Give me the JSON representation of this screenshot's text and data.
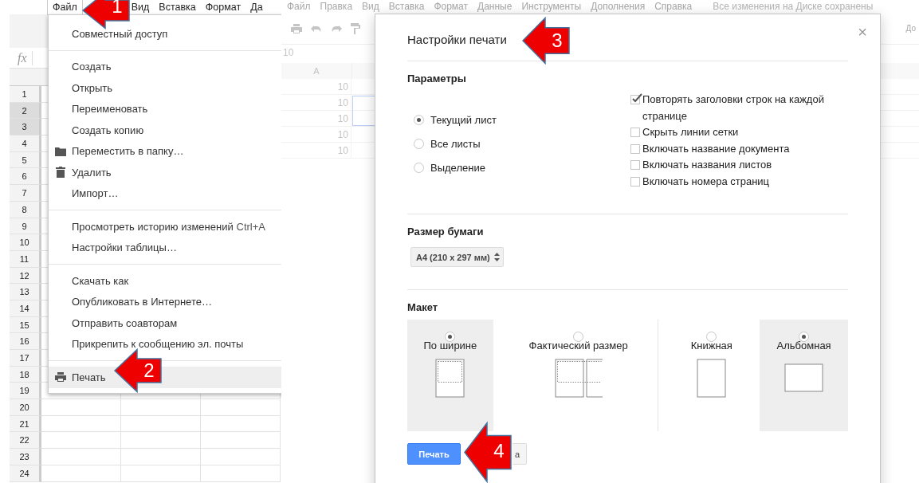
{
  "left_sheet": {
    "menu_bar": [
      {
        "label": "Файл",
        "open": true
      },
      {
        "label": "Вид",
        "open": false
      },
      {
        "label": "Вставка",
        "open": false
      },
      {
        "label": "Формат",
        "open": false
      },
      {
        "label": "Да",
        "open": false
      }
    ],
    "formula_icon": "fx",
    "rows": [
      {
        "label": "1",
        "selected": false
      },
      {
        "label": "2",
        "selected": true
      },
      {
        "label": "3",
        "selected": true
      },
      {
        "label": "4",
        "selected": false
      },
      {
        "label": "5",
        "selected": false
      },
      {
        "label": "6",
        "selected": false
      },
      {
        "label": "7",
        "selected": false
      },
      {
        "label": "8",
        "selected": false
      },
      {
        "label": "9",
        "selected": false
      },
      {
        "label": "10",
        "selected": false
      },
      {
        "label": "11",
        "selected": false
      },
      {
        "label": "12",
        "selected": false
      },
      {
        "label": "13",
        "selected": false
      },
      {
        "label": "14",
        "selected": false
      },
      {
        "label": "15",
        "selected": false
      },
      {
        "label": "16",
        "selected": false
      },
      {
        "label": "17",
        "selected": false
      },
      {
        "label": "18",
        "selected": false
      },
      {
        "label": "19",
        "selected": false
      },
      {
        "label": "20",
        "selected": false
      },
      {
        "label": "21",
        "selected": false
      },
      {
        "label": "22",
        "selected": false
      },
      {
        "label": "23",
        "selected": false
      },
      {
        "label": "24",
        "selected": false
      }
    ]
  },
  "file_menu": {
    "groups": [
      [
        {
          "label": "Совместный доступ",
          "kind": "plain",
          "highlighted": false
        }
      ],
      [
        {
          "label": "Создать",
          "kind": "plain",
          "highlighted": false
        },
        {
          "label": "Открыть",
          "kind": "plain",
          "highlighted": false
        },
        {
          "label": "Переименовать",
          "kind": "plain",
          "highlighted": false
        },
        {
          "label": "Создать копию",
          "kind": "plain",
          "highlighted": false
        },
        {
          "label": "Переместить в папку…",
          "kind": "move",
          "highlighted": false
        },
        {
          "label": "Удалить",
          "kind": "delete",
          "highlighted": false
        },
        {
          "label": "Импорт…",
          "kind": "plain",
          "highlighted": false
        }
      ],
      [
        {
          "label": "Просмотреть историю изменений",
          "kind": "plain",
          "highlighted": false,
          "shortcut": "Ctrl+A"
        },
        {
          "label": "Настройки таблицы…",
          "kind": "plain",
          "highlighted": false
        }
      ],
      [
        {
          "label": "Скачать как",
          "kind": "plain",
          "highlighted": false
        },
        {
          "label": "Опубликовать в Интернете…",
          "kind": "plain",
          "highlighted": false
        },
        {
          "label": "Отправить соавторам",
          "kind": "plain",
          "highlighted": false
        },
        {
          "label": "Прикрепить к сообщению эл. почты",
          "kind": "plain",
          "highlighted": false
        }
      ],
      [
        {
          "label": "Печать",
          "kind": "print",
          "highlighted": true
        }
      ]
    ]
  },
  "right_sheet": {
    "menu_bar": [
      "Файл",
      "Правка",
      "Вид",
      "Вставка",
      "Формат",
      "Данные",
      "Инструменты",
      "Дополнения",
      "Справка"
    ],
    "save_status": "Все изменения на Диске сохранены",
    "toolbar_edge_text": "До",
    "formula_value": "10",
    "column_header": "A",
    "cells": [
      "10",
      "10",
      "10",
      "10",
      "10"
    ]
  },
  "print_dialog": {
    "title": "Настройки печати",
    "close": "×",
    "parameters": {
      "heading": "Параметры",
      "scope": [
        {
          "label": "Текущий лист",
          "selected": true
        },
        {
          "label": "Все листы",
          "selected": false
        },
        {
          "label": "Выделение",
          "selected": false
        }
      ],
      "options": [
        {
          "label": "Повторять заголовки строк на каждой странице",
          "checked": true
        },
        {
          "label": "Скрыть линии сетки",
          "checked": false
        },
        {
          "label": "Включать название документа",
          "checked": false
        },
        {
          "label": "Включать названия листов",
          "checked": false
        },
        {
          "label": "Включать номера страниц",
          "checked": false
        }
      ]
    },
    "paper_size": {
      "heading": "Размер бумаги",
      "value": "А4 (210 x 297 мм)"
    },
    "layout": {
      "heading": "Макет",
      "scale": [
        {
          "label": "По ширине",
          "kind": "fit",
          "selected": true
        },
        {
          "label": "Фактический размер",
          "kind": "actual",
          "selected": false
        }
      ],
      "orientation": [
        {
          "label": "Книжная",
          "kind": "portrait",
          "selected": false
        },
        {
          "label": "Альбомная",
          "kind": "landscape",
          "selected": true
        }
      ]
    },
    "buttons": [
      {
        "label": "Печать",
        "kind": "primary"
      },
      {
        "label": "а",
        "kind": "secondary"
      }
    ]
  },
  "callouts": [
    {
      "number": "1"
    },
    {
      "number": "2"
    },
    {
      "number": "3"
    },
    {
      "number": "4"
    }
  ]
}
